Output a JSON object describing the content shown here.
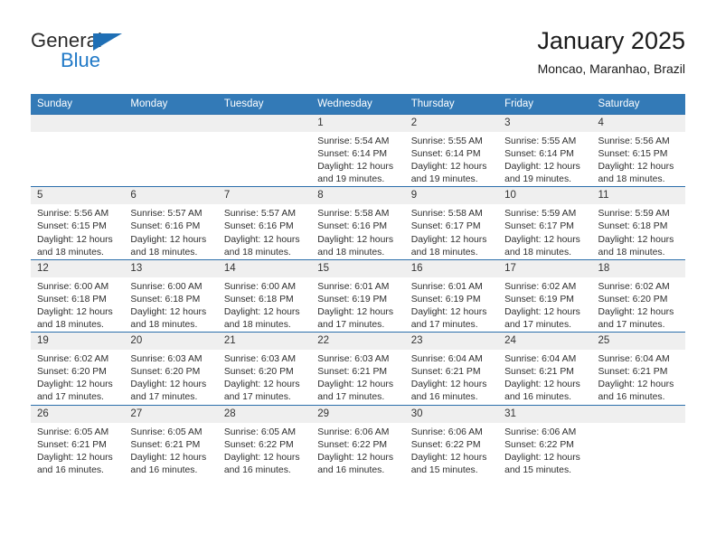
{
  "brand": {
    "name_top": "General",
    "name_bottom": "Blue",
    "accent_color": "#2079c7",
    "triangle_color": "#1f6fb5"
  },
  "header": {
    "month_title": "January 2025",
    "location": "Moncao, Maranhao, Brazil"
  },
  "theme": {
    "header_bar_color": "#337ab7",
    "row_divider_color": "#2c6fab",
    "daynum_band_color": "#efefef",
    "text_color": "#2e2e2e"
  },
  "weekday_headers": [
    "Sunday",
    "Monday",
    "Tuesday",
    "Wednesday",
    "Thursday",
    "Friday",
    "Saturday"
  ],
  "labels": {
    "sunrise_prefix": "Sunrise:",
    "sunset_prefix": "Sunset:",
    "daylight_prefix": "Daylight:"
  },
  "weeks": [
    [
      {
        "day": "",
        "sunrise": "",
        "sunset": "",
        "daylight_line1": "",
        "daylight_line2": ""
      },
      {
        "day": "",
        "sunrise": "",
        "sunset": "",
        "daylight_line1": "",
        "daylight_line2": ""
      },
      {
        "day": "",
        "sunrise": "",
        "sunset": "",
        "daylight_line1": "",
        "daylight_line2": ""
      },
      {
        "day": "1",
        "sunrise": "Sunrise: 5:54 AM",
        "sunset": "Sunset: 6:14 PM",
        "daylight_line1": "Daylight: 12 hours",
        "daylight_line2": "and 19 minutes."
      },
      {
        "day": "2",
        "sunrise": "Sunrise: 5:55 AM",
        "sunset": "Sunset: 6:14 PM",
        "daylight_line1": "Daylight: 12 hours",
        "daylight_line2": "and 19 minutes."
      },
      {
        "day": "3",
        "sunrise": "Sunrise: 5:55 AM",
        "sunset": "Sunset: 6:14 PM",
        "daylight_line1": "Daylight: 12 hours",
        "daylight_line2": "and 19 minutes."
      },
      {
        "day": "4",
        "sunrise": "Sunrise: 5:56 AM",
        "sunset": "Sunset: 6:15 PM",
        "daylight_line1": "Daylight: 12 hours",
        "daylight_line2": "and 18 minutes."
      }
    ],
    [
      {
        "day": "5",
        "sunrise": "Sunrise: 5:56 AM",
        "sunset": "Sunset: 6:15 PM",
        "daylight_line1": "Daylight: 12 hours",
        "daylight_line2": "and 18 minutes."
      },
      {
        "day": "6",
        "sunrise": "Sunrise: 5:57 AM",
        "sunset": "Sunset: 6:16 PM",
        "daylight_line1": "Daylight: 12 hours",
        "daylight_line2": "and 18 minutes."
      },
      {
        "day": "7",
        "sunrise": "Sunrise: 5:57 AM",
        "sunset": "Sunset: 6:16 PM",
        "daylight_line1": "Daylight: 12 hours",
        "daylight_line2": "and 18 minutes."
      },
      {
        "day": "8",
        "sunrise": "Sunrise: 5:58 AM",
        "sunset": "Sunset: 6:16 PM",
        "daylight_line1": "Daylight: 12 hours",
        "daylight_line2": "and 18 minutes."
      },
      {
        "day": "9",
        "sunrise": "Sunrise: 5:58 AM",
        "sunset": "Sunset: 6:17 PM",
        "daylight_line1": "Daylight: 12 hours",
        "daylight_line2": "and 18 minutes."
      },
      {
        "day": "10",
        "sunrise": "Sunrise: 5:59 AM",
        "sunset": "Sunset: 6:17 PM",
        "daylight_line1": "Daylight: 12 hours",
        "daylight_line2": "and 18 minutes."
      },
      {
        "day": "11",
        "sunrise": "Sunrise: 5:59 AM",
        "sunset": "Sunset: 6:18 PM",
        "daylight_line1": "Daylight: 12 hours",
        "daylight_line2": "and 18 minutes."
      }
    ],
    [
      {
        "day": "12",
        "sunrise": "Sunrise: 6:00 AM",
        "sunset": "Sunset: 6:18 PM",
        "daylight_line1": "Daylight: 12 hours",
        "daylight_line2": "and 18 minutes."
      },
      {
        "day": "13",
        "sunrise": "Sunrise: 6:00 AM",
        "sunset": "Sunset: 6:18 PM",
        "daylight_line1": "Daylight: 12 hours",
        "daylight_line2": "and 18 minutes."
      },
      {
        "day": "14",
        "sunrise": "Sunrise: 6:00 AM",
        "sunset": "Sunset: 6:18 PM",
        "daylight_line1": "Daylight: 12 hours",
        "daylight_line2": "and 18 minutes."
      },
      {
        "day": "15",
        "sunrise": "Sunrise: 6:01 AM",
        "sunset": "Sunset: 6:19 PM",
        "daylight_line1": "Daylight: 12 hours",
        "daylight_line2": "and 17 minutes."
      },
      {
        "day": "16",
        "sunrise": "Sunrise: 6:01 AM",
        "sunset": "Sunset: 6:19 PM",
        "daylight_line1": "Daylight: 12 hours",
        "daylight_line2": "and 17 minutes."
      },
      {
        "day": "17",
        "sunrise": "Sunrise: 6:02 AM",
        "sunset": "Sunset: 6:19 PM",
        "daylight_line1": "Daylight: 12 hours",
        "daylight_line2": "and 17 minutes."
      },
      {
        "day": "18",
        "sunrise": "Sunrise: 6:02 AM",
        "sunset": "Sunset: 6:20 PM",
        "daylight_line1": "Daylight: 12 hours",
        "daylight_line2": "and 17 minutes."
      }
    ],
    [
      {
        "day": "19",
        "sunrise": "Sunrise: 6:02 AM",
        "sunset": "Sunset: 6:20 PM",
        "daylight_line1": "Daylight: 12 hours",
        "daylight_line2": "and 17 minutes."
      },
      {
        "day": "20",
        "sunrise": "Sunrise: 6:03 AM",
        "sunset": "Sunset: 6:20 PM",
        "daylight_line1": "Daylight: 12 hours",
        "daylight_line2": "and 17 minutes."
      },
      {
        "day": "21",
        "sunrise": "Sunrise: 6:03 AM",
        "sunset": "Sunset: 6:20 PM",
        "daylight_line1": "Daylight: 12 hours",
        "daylight_line2": "and 17 minutes."
      },
      {
        "day": "22",
        "sunrise": "Sunrise: 6:03 AM",
        "sunset": "Sunset: 6:21 PM",
        "daylight_line1": "Daylight: 12 hours",
        "daylight_line2": "and 17 minutes."
      },
      {
        "day": "23",
        "sunrise": "Sunrise: 6:04 AM",
        "sunset": "Sunset: 6:21 PM",
        "daylight_line1": "Daylight: 12 hours",
        "daylight_line2": "and 16 minutes."
      },
      {
        "day": "24",
        "sunrise": "Sunrise: 6:04 AM",
        "sunset": "Sunset: 6:21 PM",
        "daylight_line1": "Daylight: 12 hours",
        "daylight_line2": "and 16 minutes."
      },
      {
        "day": "25",
        "sunrise": "Sunrise: 6:04 AM",
        "sunset": "Sunset: 6:21 PM",
        "daylight_line1": "Daylight: 12 hours",
        "daylight_line2": "and 16 minutes."
      }
    ],
    [
      {
        "day": "26",
        "sunrise": "Sunrise: 6:05 AM",
        "sunset": "Sunset: 6:21 PM",
        "daylight_line1": "Daylight: 12 hours",
        "daylight_line2": "and 16 minutes."
      },
      {
        "day": "27",
        "sunrise": "Sunrise: 6:05 AM",
        "sunset": "Sunset: 6:21 PM",
        "daylight_line1": "Daylight: 12 hours",
        "daylight_line2": "and 16 minutes."
      },
      {
        "day": "28",
        "sunrise": "Sunrise: 6:05 AM",
        "sunset": "Sunset: 6:22 PM",
        "daylight_line1": "Daylight: 12 hours",
        "daylight_line2": "and 16 minutes."
      },
      {
        "day": "29",
        "sunrise": "Sunrise: 6:06 AM",
        "sunset": "Sunset: 6:22 PM",
        "daylight_line1": "Daylight: 12 hours",
        "daylight_line2": "and 16 minutes."
      },
      {
        "day": "30",
        "sunrise": "Sunrise: 6:06 AM",
        "sunset": "Sunset: 6:22 PM",
        "daylight_line1": "Daylight: 12 hours",
        "daylight_line2": "and 15 minutes."
      },
      {
        "day": "31",
        "sunrise": "Sunrise: 6:06 AM",
        "sunset": "Sunset: 6:22 PM",
        "daylight_line1": "Daylight: 12 hours",
        "daylight_line2": "and 15 minutes."
      },
      {
        "day": "",
        "sunrise": "",
        "sunset": "",
        "daylight_line1": "",
        "daylight_line2": ""
      }
    ]
  ]
}
